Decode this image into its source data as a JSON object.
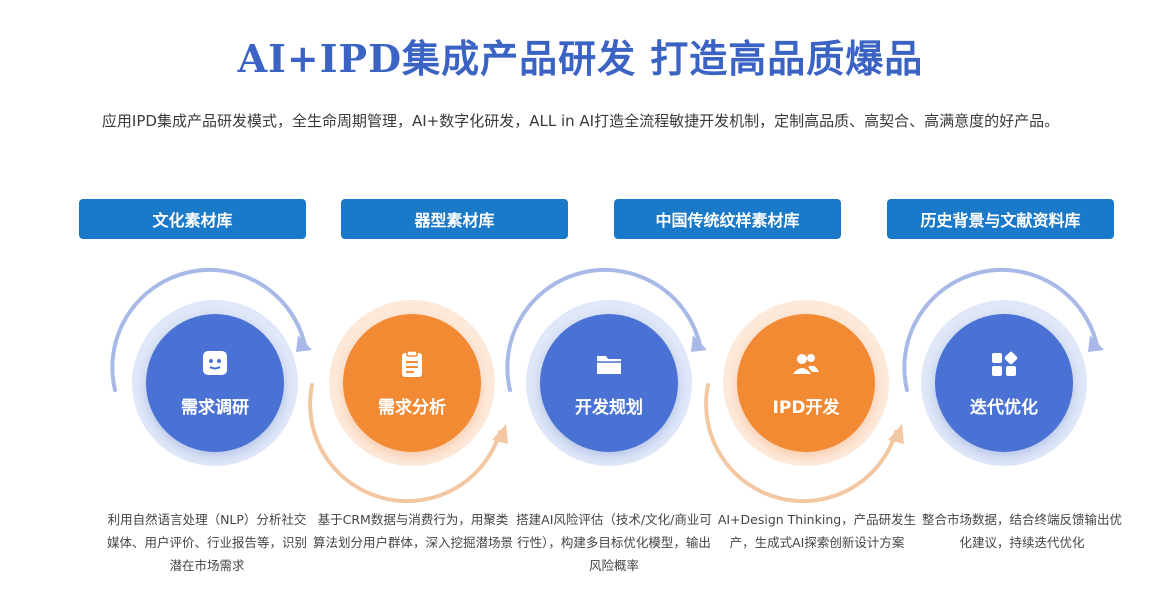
{
  "title": "AI+IPD集成产品研发 打造高品质爆品",
  "subtitle": "应用IPD集成产品研发模式，全生命周期管理，AI+数字化研发，ALL in AI打造全流程敏捷开发机制，定制高品质、高契合、高满意度的好产品。",
  "categories": [
    "文化素材库",
    "器型素材库",
    "中国传统纹样素材库",
    "历史背景与文献资料库"
  ],
  "steps": [
    {
      "label": "需求调研",
      "icon": "chat-bubble-icon",
      "color": "#4a72d4",
      "desc": "利用自然语言处理（NLP）分析社交媒体、用户评价、行业报告等，识别潜在市场需求"
    },
    {
      "label": "需求分析",
      "icon": "clipboard-icon",
      "color": "#f18a33",
      "desc": "基于CRM数据与消费行为，用聚类算法划分用户群体，深入挖掘潜场景"
    },
    {
      "label": "开发规划",
      "icon": "folder-icon",
      "color": "#4a72d4",
      "desc": "搭建AI风险评估（技术/文化/商业可行性），构建多目标优化模型，输出风险概率"
    },
    {
      "label": "IPD开发",
      "icon": "users-icon",
      "color": "#f18a33",
      "desc": "AI+Design Thinking，产品研发生产，生成式AI探索创新设计方案"
    },
    {
      "label": "迭代优化",
      "icon": "grid-icon",
      "color": "#4a72d4",
      "desc": "整合市场数据，结合终端反馈输出优化建议，持续迭代优化"
    }
  ],
  "colors": {
    "accent_blue": "#4a72d4",
    "accent_orange": "#f18a33",
    "category_bg": "#1a7ac9",
    "title": "#3a63c4"
  }
}
